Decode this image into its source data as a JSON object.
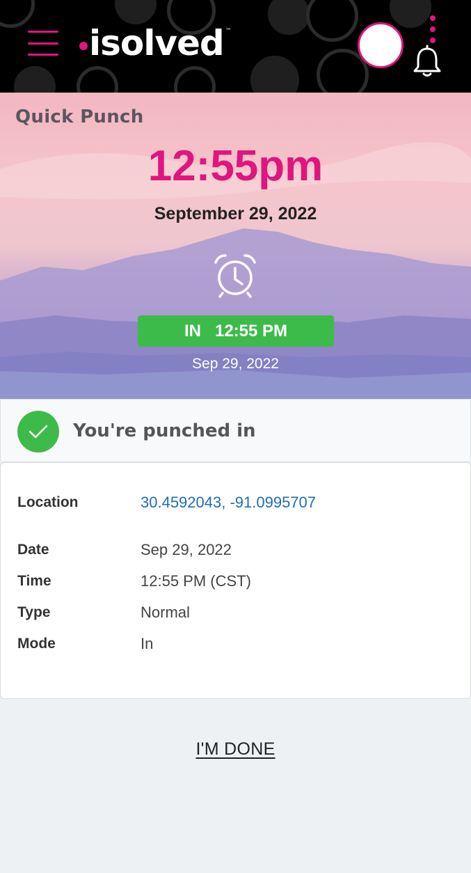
{
  "header": {
    "logo_text": "isolved",
    "logo_tm": "™",
    "colors": {
      "accent": "#e0157f",
      "background": "#000000"
    }
  },
  "hero": {
    "title": "Quick Punch",
    "current_time": "12:55pm",
    "current_date": "September 29, 2022",
    "punch_mode": "IN",
    "punch_time": "12:55 PM",
    "punch_date": "Sep 29, 2022",
    "colors": {
      "time": "#e0157f",
      "pill": "#3dbb4a"
    }
  },
  "status": {
    "message": "You're punched in"
  },
  "details": {
    "location": {
      "label": "Location",
      "value": "30.4592043, -91.0995707"
    },
    "date": {
      "label": "Date",
      "value": "Sep 29, 2022"
    },
    "time": {
      "label": "Time",
      "value": "12:55 PM (CST)"
    },
    "type": {
      "label": "Type",
      "value": "Normal"
    },
    "mode": {
      "label": "Mode",
      "value": "In"
    }
  },
  "actions": {
    "done_label": "I'M DONE"
  }
}
